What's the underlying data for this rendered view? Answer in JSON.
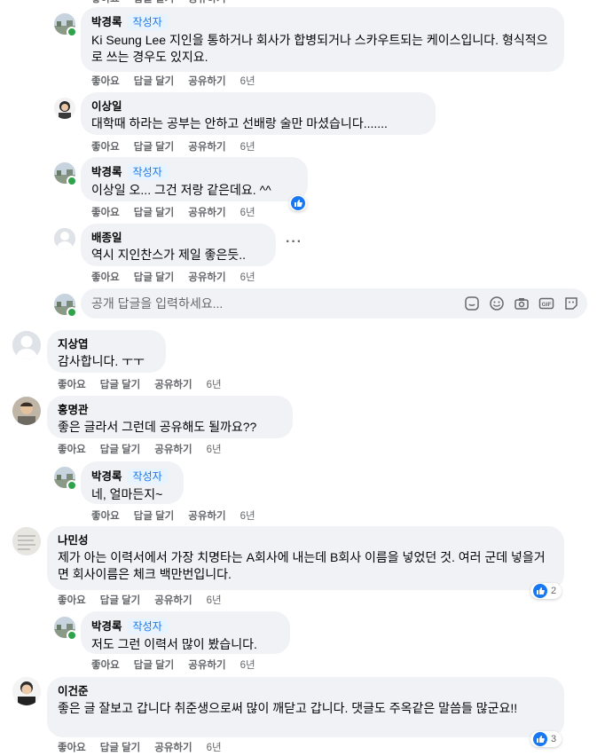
{
  "labels": {
    "like": "좋아요",
    "reply": "답글 달기",
    "share": "공유하기",
    "author_badge": "작성자"
  },
  "comments": [
    {
      "name": "박경록",
      "text": "Ki Seung Lee 지인을 통하거나 회사가 합병되거나 스카우트되는 케이스입니다. 형식적으로 쓰는 경우도 있지요.",
      "time": "6년"
    },
    {
      "name": "이상일",
      "text": "대학때 하라는 공부는 안하고 선배랑 술만 마셨습니다.......",
      "time": "6년"
    },
    {
      "name": "박경록",
      "text": "이상일 오... 그건 저랑 같은데요. ^^",
      "time": "6년"
    },
    {
      "name": "배종일",
      "text": "역시 지인찬스가 제일 좋은듯..",
      "time": "6년"
    },
    {
      "name": "지상엽",
      "text": "감사합니다. ㅜㅜ",
      "time": "6년"
    },
    {
      "name": "홍명관",
      "text": "좋은 글라서 그런데 공유해도 될까요??",
      "time": "6년"
    },
    {
      "name": "박경록",
      "text": "네, 얼마든지~",
      "time": "6년"
    },
    {
      "name": "나민성",
      "text": "제가 아는 이력서에서 가장 치명타는 A회사에 내는데 B회사 이름을 넣었던 것. 여러 군데 넣을거면 회사이름은 체크 백만번입니다.",
      "time": "6년",
      "reactions": "2"
    },
    {
      "name": "박경록",
      "text": "저도 그런 이력서 많이 봤습니다.",
      "time": "6년"
    },
    {
      "name": "이건준",
      "text": "좋은 글 잘보고 갑니다 취준생으로써 많이 깨닫고 갑니다. 댓글도 주옥같은 말씀들 많군요!!",
      "time": "6년",
      "reactions": "3"
    }
  ],
  "reply_input": {
    "placeholder": "공개 답글을 입력하세요..."
  },
  "colors": {
    "accent": "#1877f2",
    "bubble": "#f0f2f5",
    "online": "#31a24c",
    "muted": "#65676b"
  },
  "icons": [
    "like-icon",
    "more-icon",
    "sticker-icon",
    "emoji-icon",
    "camera-icon",
    "gif-icon",
    "avatar-sticker-icon"
  ]
}
